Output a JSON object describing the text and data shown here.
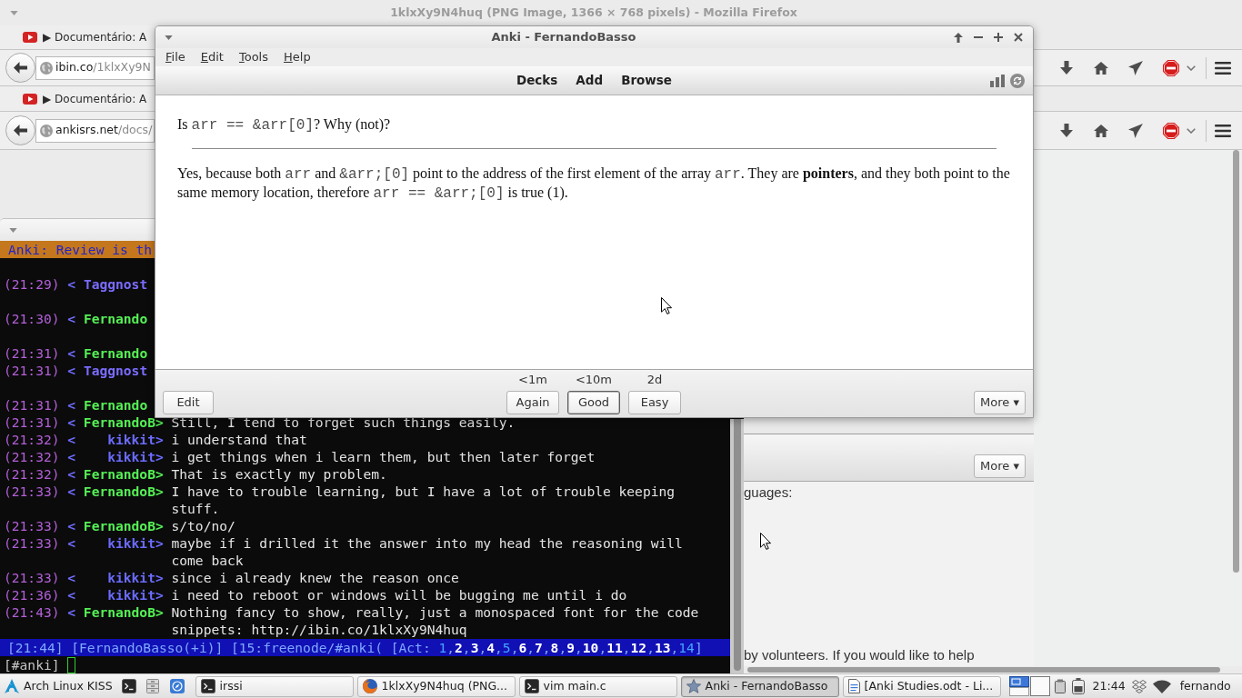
{
  "firefox": {
    "title": "1klxXy9N4huq (PNG Image, 1366 × 768 pixels) - Mozilla Firefox",
    "tab": "▶ Documentário: A",
    "url_host": "ibin.co",
    "url_path": "/1klxXy9N"
  },
  "image_view": {
    "tab": "▶ Documentário: A",
    "url_host": "ankisrs.net",
    "url_path": "/docs/",
    "more_button": "More ▾",
    "page_text": [
      "guages:",
      "by volunteers. If you would like to help"
    ]
  },
  "terminal": {
    "notice": "Anki: Review is th",
    "lines": [
      {
        "kind": "blank"
      },
      {
        "kind": "cut",
        "time": "(21:29)",
        "mark": "<",
        "nick": "Taggnost",
        "color": "#7a6cff"
      },
      {
        "kind": "blank"
      },
      {
        "kind": "cut",
        "time": "(21:30)",
        "mark": "<",
        "nick": "Fernando",
        "color": "#55f055"
      },
      {
        "kind": "blank"
      },
      {
        "kind": "cut",
        "time": "(21:31)",
        "mark": "<",
        "nick": "Fernando",
        "color": "#55f055"
      },
      {
        "kind": "cut",
        "time": "(21:31)",
        "mark": "<",
        "nick": "Taggnost",
        "color": "#7a6cff"
      },
      {
        "kind": "blank"
      },
      {
        "kind": "cut",
        "time": "(21:31)",
        "mark": "<",
        "nick": "Fernando",
        "color": "#55f055"
      },
      {
        "kind": "message",
        "time": "(21:31)",
        "mark": "<",
        "nick": "FernandoB>",
        "color": "#55f055",
        "text": "Still, I tend to forget such things easily."
      },
      {
        "kind": "message",
        "time": "(21:32)",
        "mark": "<",
        "nick": "kikkit>",
        "color": "#6b6bff",
        "text": "i understand that"
      },
      {
        "kind": "message",
        "time": "(21:32)",
        "mark": "<",
        "nick": "kikkit>",
        "color": "#6b6bff",
        "text": "i get things when i learn them, but then later forget"
      },
      {
        "kind": "message",
        "time": "(21:32)",
        "mark": "<",
        "nick": "FernandoB>",
        "color": "#55f055",
        "text": "That is exactly my problem."
      },
      {
        "kind": "message",
        "time": "(21:33)",
        "mark": "<",
        "nick": "FernandoB>",
        "color": "#55f055",
        "text": "I have to trouble learning, but I have a lot of trouble keeping stuff."
      },
      {
        "kind": "message",
        "time": "(21:33)",
        "mark": "<",
        "nick": "FernandoB>",
        "color": "#55f055",
        "text": "s/to/no/"
      },
      {
        "kind": "message",
        "time": "(21:33)",
        "mark": "<",
        "nick": "kikkit>",
        "color": "#6b6bff",
        "text": "maybe if i drilled it the answer into my head the reasoning will come back"
      },
      {
        "kind": "message",
        "time": "(21:33)",
        "mark": "<",
        "nick": "kikkit>",
        "color": "#6b6bff",
        "text": "since i already knew the reason once"
      },
      {
        "kind": "message",
        "time": "(21:36)",
        "mark": "<",
        "nick": "kikkit>",
        "color": "#6b6bff",
        "text": "i need to reboot or windows will be bugging me until i do"
      },
      {
        "kind": "message",
        "time": "(21:43)",
        "mark": "<",
        "nick": "FernandoB>",
        "color": "#55f055",
        "text": "Nothing fancy to show, really, just a monospaced font for the code snippets: http://ibin.co/1klxXy9N4huq"
      }
    ],
    "status": {
      "items": [
        "[21:44]",
        "[FernandoBasso(+i)]",
        "[15:freenode/#anki("
      ],
      "act_open": "[Act:",
      "act": [
        {
          "n": "1",
          "highlight": false
        },
        {
          "n": "2",
          "highlight": true
        },
        {
          "n": "3",
          "highlight": true
        },
        {
          "n": "4",
          "highlight": true
        },
        {
          "n": "5",
          "highlight": false
        },
        {
          "n": "6",
          "highlight": true
        },
        {
          "n": "7",
          "highlight": true
        },
        {
          "n": "8",
          "highlight": true
        },
        {
          "n": "9",
          "highlight": true
        },
        {
          "n": "10",
          "highlight": true
        },
        {
          "n": "11",
          "highlight": true
        },
        {
          "n": "12",
          "highlight": true
        },
        {
          "n": "13",
          "highlight": true
        },
        {
          "n": "14",
          "highlight": false
        }
      ],
      "separator": ",",
      "act_close": "]"
    },
    "prompt": "[#anki]"
  },
  "anki": {
    "title": "Anki - FernandoBasso",
    "menu": [
      "File",
      "Edit",
      "Tools",
      "Help"
    ],
    "toolbar": [
      "Decks",
      "Add",
      "Browse"
    ],
    "question": [
      {
        "kind": "text",
        "text": "Is "
      },
      {
        "kind": "code",
        "text": "arr == &arr[0]"
      },
      {
        "kind": "text",
        "text": "? Why (not)?"
      }
    ],
    "answer": [
      {
        "kind": "text",
        "text": "Yes, because both "
      },
      {
        "kind": "code",
        "text": "arr"
      },
      {
        "kind": "text",
        "text": " and "
      },
      {
        "kind": "code",
        "text": "&arr;[0]"
      },
      {
        "kind": "text",
        "text": " point to the address of the first element of the array "
      },
      {
        "kind": "code",
        "text": "arr"
      },
      {
        "kind": "text",
        "text": ". They are **pointers**, and they both point to the same memory location, therefore "
      },
      {
        "kind": "code",
        "text": "arr == &arr;[0]"
      },
      {
        "kind": "text",
        "text": " is true (1)."
      }
    ],
    "edit_button": "Edit",
    "answer_buttons": [
      {
        "interval": "<1m",
        "label": "Again",
        "selected": false
      },
      {
        "interval": "<10m",
        "label": "Good",
        "selected": true
      },
      {
        "interval": "2d",
        "label": "Easy",
        "selected": false
      }
    ],
    "more_button": "More ▾"
  },
  "taskbar": {
    "start": "Arch Linux KISS",
    "tasks": [
      {
        "kind": "terminal",
        "label": "irssi",
        "selected": false
      },
      {
        "kind": "browser",
        "label": "1klxXy9N4huq (PNG...",
        "selected": false
      },
      {
        "kind": "terminal",
        "label": "vim main.c",
        "selected": false
      },
      {
        "kind": "flashcards",
        "label": "Anki - FernandoBasso",
        "selected": true
      },
      {
        "kind": "document",
        "label": "[Anki Studies.odt - Li...",
        "selected": false
      }
    ],
    "clock": "21:44",
    "user": "fernando"
  }
}
